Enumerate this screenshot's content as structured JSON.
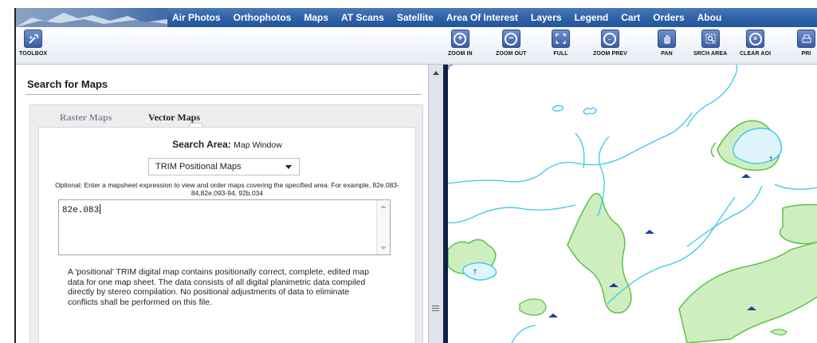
{
  "nav": {
    "items": [
      "Air Photos",
      "Orthophotos",
      "Maps",
      "AT Scans",
      "Satellite",
      "Area Of Interest",
      "Layers",
      "Legend",
      "Cart",
      "Orders",
      "Abou"
    ]
  },
  "toolbar": {
    "toolbox_label": "TOOLBOX",
    "tools": [
      {
        "label": "ZOOM IN",
        "icon": "zoom-in-icon"
      },
      {
        "label": "ZOOM OUT",
        "icon": "zoom-out-icon"
      },
      {
        "label": "FULL",
        "icon": "full-extent-icon"
      },
      {
        "label": "ZOOM PREV",
        "icon": "zoom-prev-icon"
      },
      {
        "label": "PAN",
        "icon": "pan-hand-icon"
      },
      {
        "label": "SRCH AREA",
        "icon": "search-area-icon"
      },
      {
        "label": "CLEAR AOI",
        "icon": "clear-aoi-icon"
      },
      {
        "label": "PRI",
        "icon": "print-icon"
      }
    ]
  },
  "panel": {
    "title": "Search for Maps",
    "tabs": [
      "Raster Maps",
      "Vector Maps"
    ],
    "active_tab": "Vector Maps",
    "search_area_label": "Search Area:",
    "search_area_value": "Map Window",
    "select_value": "TRIM Positional Maps",
    "optional_text": "Optional: Enter a mapsheet expression to view and order maps covering the specified area. For example, 82e.083-84,82e.093-94, 92b.034",
    "mapsheet_value": "82e.083",
    "description": "A 'positional' TRIM digital map contains positionally correct, complete, edited map data for one map sheet. The data consists of all digital planimetric data compiled directly by stereo compilation. No positional adjustments of data to eliminate conflicts shall be performed on this file."
  },
  "colors": {
    "nav_bg": "#2a5fa6",
    "water_line": "#3cc8e8",
    "vegetation_fill": "#cfeec0",
    "vegetation_edge": "#5cc24a",
    "lake_fill": "#dff4fb",
    "lake_symbol": "#1a3fa0"
  }
}
